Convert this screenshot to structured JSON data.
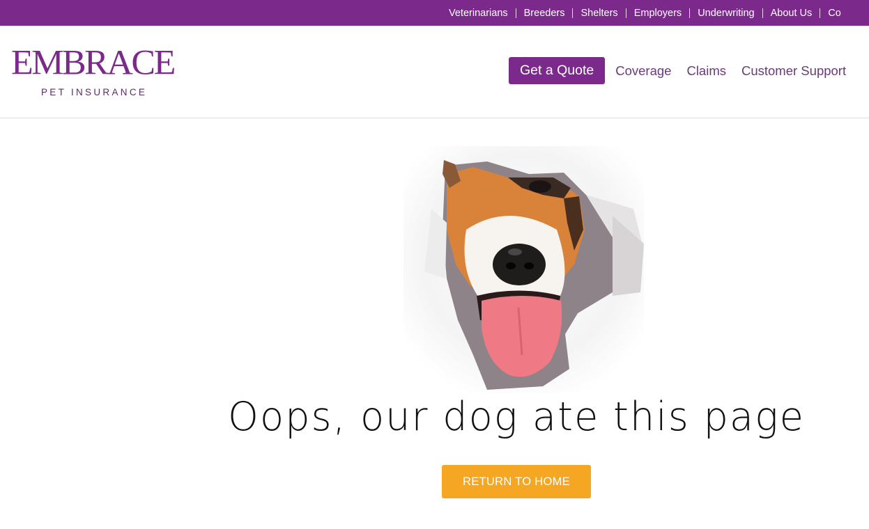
{
  "topbar": {
    "links": [
      "Veterinarians",
      "Breeders",
      "Shelters",
      "Employers",
      "Underwriting",
      "About Us",
      "Co"
    ]
  },
  "header": {
    "logo_word": "EMBRACE",
    "logo_sub": "PET INSURANCE",
    "quote_label": "Get a Quote",
    "nav": [
      "Coverage",
      "Claims",
      "Customer Support"
    ]
  },
  "main": {
    "headline": "Oops, our dog ate this page",
    "return_label": "RETURN TO HOME"
  },
  "colors": {
    "brand_purple": "#7b2a8c",
    "accent_orange": "#f5a623"
  }
}
